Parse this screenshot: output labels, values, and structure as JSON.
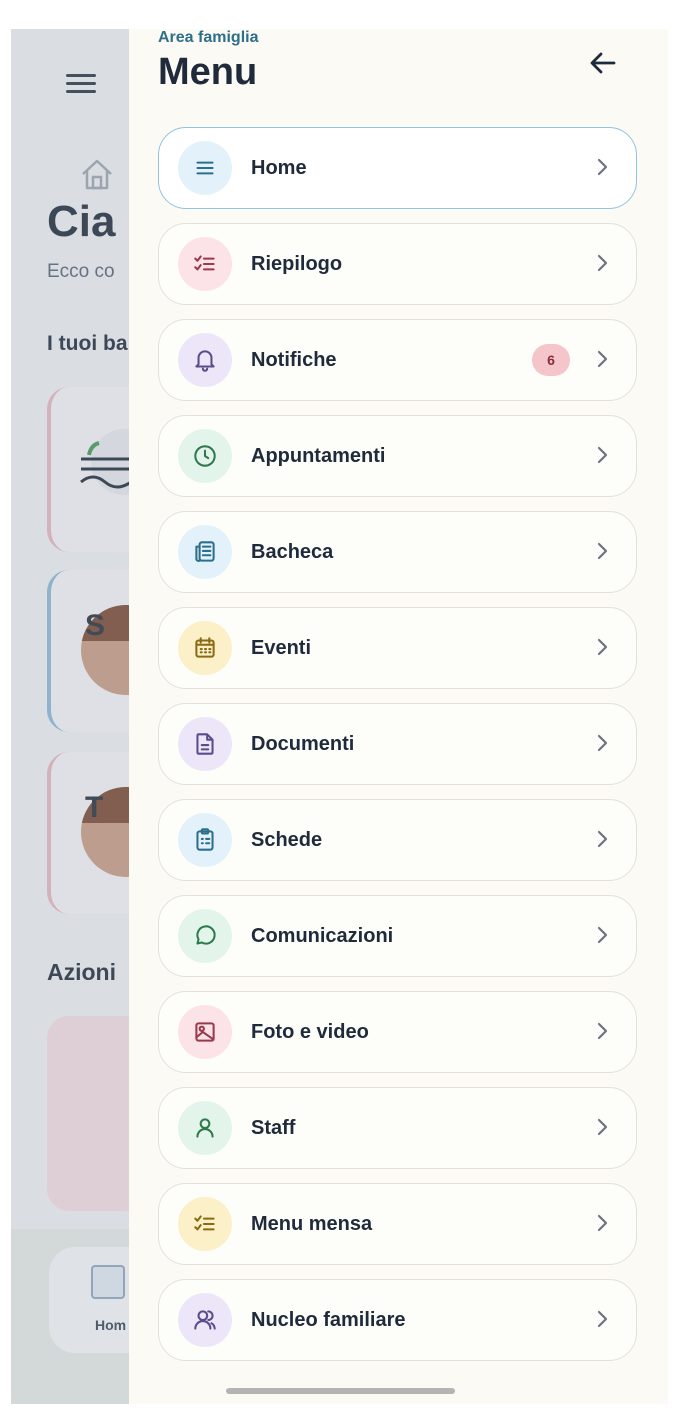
{
  "background": {
    "greeting": "Cia",
    "subtitle": "Ecco co",
    "kids_heading": "I tuoi ba",
    "card_letters": [
      "S",
      "T"
    ],
    "actions_heading": "Azioni",
    "bottom_nav_label": "Hom"
  },
  "drawer": {
    "subtitle": "Area famiglia",
    "title": "Menu",
    "back_icon": "arrow-left-icon",
    "items": [
      {
        "label": "Home",
        "icon": "menu-lines-icon",
        "icon_bg": "#e3f2fa",
        "icon_color": "#2b6f8c",
        "active": true
      },
      {
        "label": "Riepilogo",
        "icon": "checklist-icon",
        "icon_bg": "#fbe3e7",
        "icon_color": "#9b3a4a"
      },
      {
        "label": "Notifiche",
        "icon": "bell-icon",
        "icon_bg": "#ece6f8",
        "icon_color": "#5d4b8a",
        "badge": "6"
      },
      {
        "label": "Appuntamenti",
        "icon": "clock-icon",
        "icon_bg": "#e3f5ea",
        "icon_color": "#2f7a4d"
      },
      {
        "label": "Bacheca",
        "icon": "newspaper-icon",
        "icon_bg": "#e3f2fa",
        "icon_color": "#2b6f8c"
      },
      {
        "label": "Eventi",
        "icon": "calendar-icon",
        "icon_bg": "#fbf0c8",
        "icon_color": "#8a6a12"
      },
      {
        "label": "Documenti",
        "icon": "document-icon",
        "icon_bg": "#ece6f8",
        "icon_color": "#5d4b8a"
      },
      {
        "label": "Schede",
        "icon": "clipboard-icon",
        "icon_bg": "#e3f2fa",
        "icon_color": "#2b6f8c"
      },
      {
        "label": "Comunicazioni",
        "icon": "chat-bubble-icon",
        "icon_bg": "#e3f5ea",
        "icon_color": "#2f7a4d"
      },
      {
        "label": "Foto e video",
        "icon": "image-icon",
        "icon_bg": "#fbe3e7",
        "icon_color": "#9b3a4a"
      },
      {
        "label": "Staff",
        "icon": "user-icon",
        "icon_bg": "#e3f5ea",
        "icon_color": "#2f7a4d"
      },
      {
        "label": "Menu mensa",
        "icon": "checklist-icon",
        "icon_bg": "#fbf0c8",
        "icon_color": "#8a6a12"
      },
      {
        "label": "Nucleo familiare",
        "icon": "users-icon",
        "icon_bg": "#ece6f8",
        "icon_color": "#5d4b8a"
      }
    ]
  }
}
